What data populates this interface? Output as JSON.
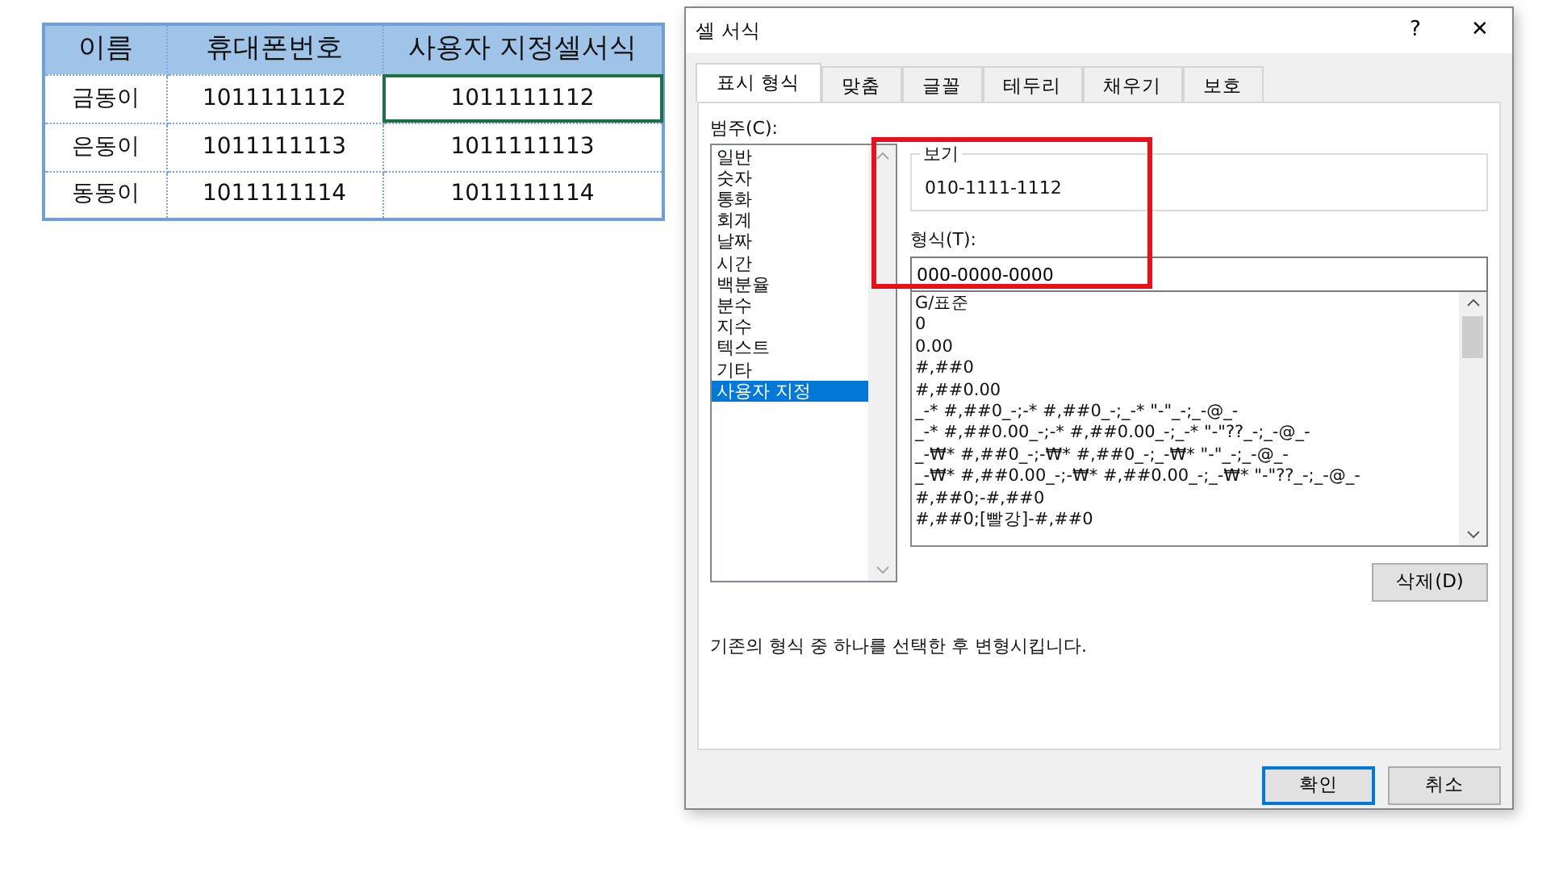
{
  "sheet": {
    "columns": [
      "이름",
      "휴대폰번호",
      "사용자 지정셀서식"
    ],
    "rows": [
      {
        "cells": [
          {
            "text": "금동이",
            "selected": false
          },
          {
            "text": "1011111112",
            "selected": false
          },
          {
            "text": "1011111112",
            "selected": true
          }
        ]
      },
      {
        "cells": [
          {
            "text": "은동이",
            "selected": false
          },
          {
            "text": "1011111113",
            "selected": false
          },
          {
            "text": "1011111113",
            "selected": false
          }
        ]
      },
      {
        "cells": [
          {
            "text": "동동이",
            "selected": false
          },
          {
            "text": "1011111114",
            "selected": false
          },
          {
            "text": "1011111114",
            "selected": false
          }
        ]
      }
    ]
  },
  "dialog": {
    "title": "셀 서식",
    "help": "?",
    "close": "✕",
    "tabs": [
      {
        "label": "표시 형식",
        "selected": true
      },
      {
        "label": "맞춤",
        "selected": false
      },
      {
        "label": "글꼴",
        "selected": false
      },
      {
        "label": "테두리",
        "selected": false
      },
      {
        "label": "채우기",
        "selected": false
      },
      {
        "label": "보호",
        "selected": false
      }
    ],
    "category_label": "범주(C):",
    "categories": [
      {
        "label": "일반",
        "selected": false
      },
      {
        "label": "숫자",
        "selected": false
      },
      {
        "label": "통화",
        "selected": false
      },
      {
        "label": "회계",
        "selected": false
      },
      {
        "label": "날짜",
        "selected": false
      },
      {
        "label": "시간",
        "selected": false
      },
      {
        "label": "백분율",
        "selected": false
      },
      {
        "label": "분수",
        "selected": false
      },
      {
        "label": "지수",
        "selected": false
      },
      {
        "label": "텍스트",
        "selected": false
      },
      {
        "label": "기타",
        "selected": false
      },
      {
        "label": "사용자 지정",
        "selected": true
      }
    ],
    "preview": {
      "label": "보기",
      "value": "010-1111-1112"
    },
    "format_label": "형식(T):",
    "format_value": "000-0000-0000",
    "formats": [
      "G/표준",
      "0",
      "0.00",
      "#,##0",
      "#,##0.00",
      "_-* #,##0_-;-* #,##0_-;_-* \"-\"_-;_-@_-",
      "_-* #,##0.00_-;-* #,##0.00_-;_-* \"-\"??_-;_-@_-",
      "_-₩* #,##0_-;-₩* #,##0_-;_-₩* \"-\"_-;_-@_-",
      "_-₩* #,##0.00_-;-₩* #,##0.00_-;_-₩* \"-\"??_-;_-@_-",
      "#,##0;-#,##0",
      "#,##0;[빨강]-#,##0"
    ],
    "delete_button": "삭제(D)",
    "description": "기존의 형식 중 하나를 선택한 후 변형시킵니다.",
    "buttons": [
      {
        "label": "확인",
        "default": true
      },
      {
        "label": "취소",
        "default": false
      }
    ]
  },
  "annotation": {
    "kind": "rectangle",
    "color": "#e8101a"
  }
}
